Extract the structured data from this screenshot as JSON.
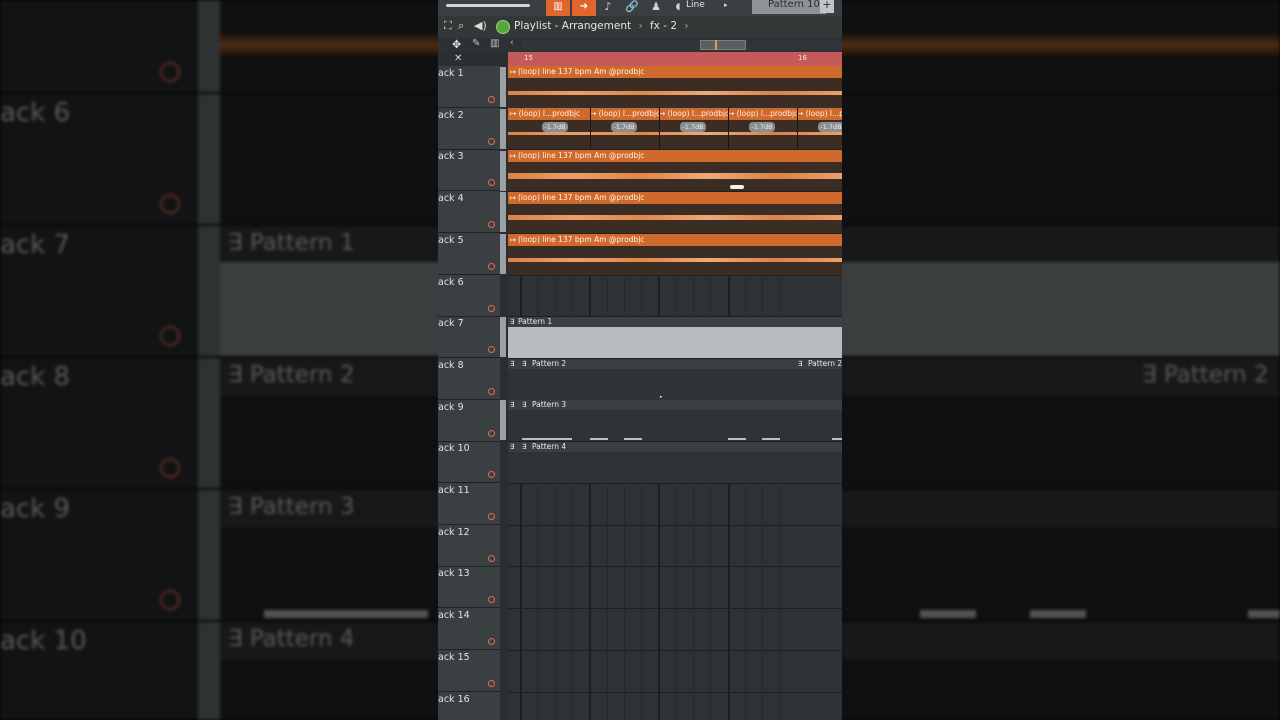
{
  "topbar": {
    "line_label": "Line",
    "pattern_selector": "Pattern 10",
    "plus_label": "+"
  },
  "titlebar": {
    "title": "Playlist - Arrangement",
    "sep": "›",
    "fx": "fx - 2"
  },
  "timeline": {
    "bar_left": "15",
    "bar_right": "16"
  },
  "tracks": [
    {
      "name": "ack 1"
    },
    {
      "name": "ack 2"
    },
    {
      "name": "ack 3"
    },
    {
      "name": "ack 4"
    },
    {
      "name": "ack 5"
    },
    {
      "name": "ack 6"
    },
    {
      "name": "ack 7"
    },
    {
      "name": "ack 8"
    },
    {
      "name": "ack 9"
    },
    {
      "name": "ack 10"
    },
    {
      "name": "ack 11"
    },
    {
      "name": "ack 12"
    },
    {
      "name": "ack 13"
    },
    {
      "name": "ack 14"
    },
    {
      "name": "ack 15"
    },
    {
      "name": "ack 16"
    }
  ],
  "audio_clip_label": "(loop) line 137 bpm Am @prodbjc",
  "short_clip_label": "(loop) l...prodbjc",
  "short_clip_label_cut": "(loop) l...p",
  "gain_label": "-1.7dB",
  "patterns": {
    "p1": "Pattern 1",
    "p2": "Pattern 2",
    "p3": "Pattern 3",
    "p4": "Pattern 4"
  },
  "backdrop": {
    "t6": "ack 6",
    "t7": "ack 7",
    "t8": "ack 8",
    "t9": "ack 9",
    "t10": "ack 10",
    "p1": "∃ Pattern 1",
    "p2": "∃ Pattern 2",
    "p2b": "∃ Pattern 2",
    "p3": "∃ Pattern 3",
    "p4": "∃ Pattern 4"
  },
  "colors": {
    "accent": "#e0662d",
    "audio_clip": "#d06a2c",
    "timeline": "#c45a5a",
    "record_dot": "#e66a57"
  }
}
